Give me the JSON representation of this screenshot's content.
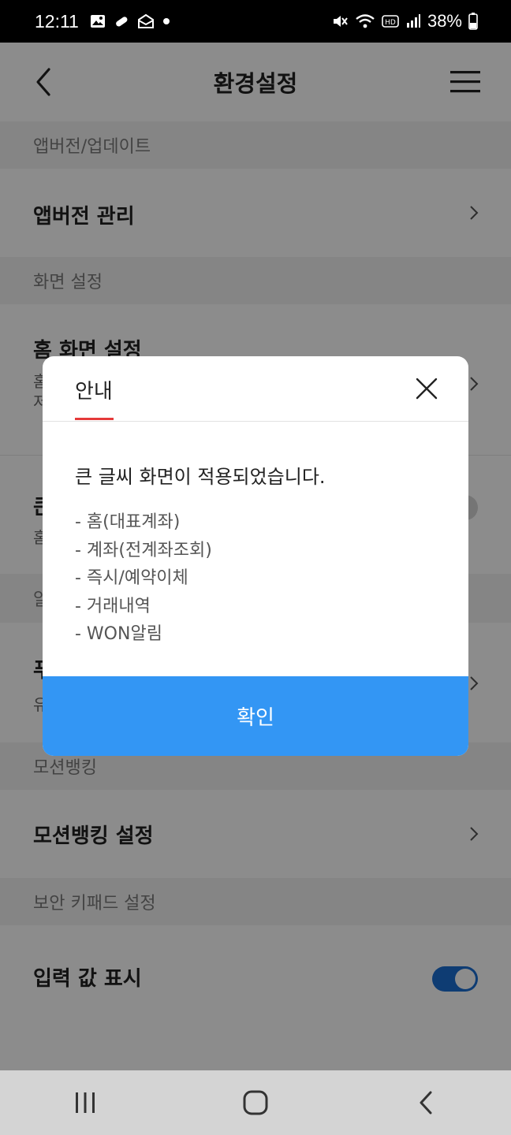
{
  "status_bar": {
    "time": "12:11",
    "battery": "38%",
    "left_icons": [
      "gallery-icon",
      "pill-icon",
      "mail-open-icon",
      "dot-icon"
    ],
    "right_icons": [
      "mute-vibrate-icon",
      "wifi-icon",
      "hd-icon",
      "signal-icon",
      "battery-icon"
    ]
  },
  "header": {
    "title": "환경설정",
    "back_icon": "chevron-left-icon",
    "menu_icon": "hamburger-menu-icon"
  },
  "sections": {
    "app_version_title": "앱버전/업데이트",
    "app_version_row": "앱버전 관리",
    "screen_title": "화면 설정",
    "home_screen_row": "홈 화면 설정",
    "home_screen_sub_1": "홈",
    "home_screen_sub_2": "저",
    "large_text_row": "큰",
    "large_text_sub": "홈",
    "notify_title": "알",
    "push_row": "푸",
    "push_sub": "유",
    "motion_title": "모션뱅킹",
    "motion_row": "모션뱅킹 설정",
    "keypad_title": "보안 키패드 설정",
    "input_display_row": "입력 값 표시"
  },
  "toggles": {
    "large_text": false,
    "input_display": true
  },
  "modal": {
    "tab_label": "안내",
    "message": "큰 글씨 화면이 적용되었습니다.",
    "items": [
      "- 홈(대표계좌)",
      "- 계좌(전계좌조회)",
      "- 즉시/예약이체",
      "- 거래내역",
      "- WON알림"
    ],
    "confirm_label": "확인",
    "accent_color": "#e53a3a",
    "button_color": "#3396f4"
  },
  "colors": {
    "toggle_on": "#1a6dd2",
    "overlay": "rgba(0,0,0,0.45)"
  },
  "navbar": {
    "icons": [
      "recent-apps-icon",
      "home-icon",
      "back-icon"
    ]
  }
}
